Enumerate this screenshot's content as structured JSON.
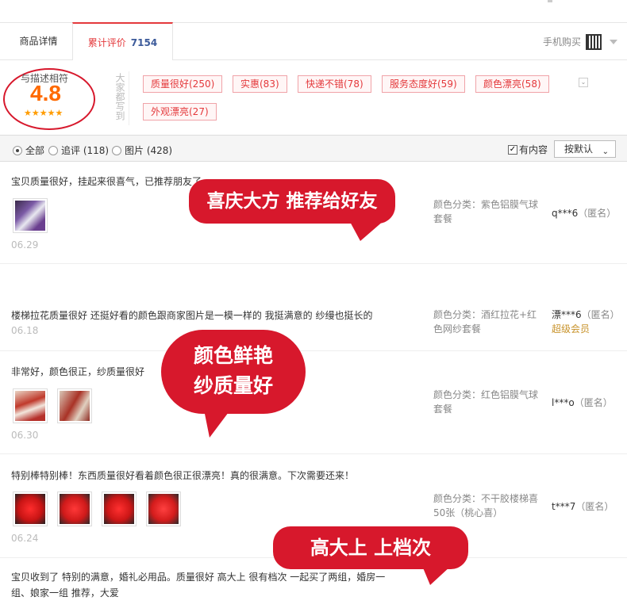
{
  "tabs": {
    "detail": "商品详情",
    "reviews": "累计评价",
    "review_count": "7154",
    "mobile": "手机购买"
  },
  "rating": {
    "label": "与描述相符",
    "score": "4.8",
    "stars": "★★★★★",
    "side_text": "大家都写到",
    "tags": [
      "质量很好(250)",
      "实惠(83)",
      "快递不错(78)",
      "服务态度好(59)",
      "颜色漂亮(58)",
      "外观漂亮(27)"
    ],
    "expand_icon": "chevron-down-icon"
  },
  "filter": {
    "all": "全部",
    "followup": "追评 (118)",
    "images": "图片 (428)",
    "has_content": "有内容",
    "sort": "按默认",
    "sort_caret": "⌄"
  },
  "reviews": [
    {
      "text": "宝贝质量很好，挂起来很喜气，已推荐朋友了",
      "date": "06.29",
      "meta": "颜色分类：紫色铝膜气球套餐",
      "user": "q***6",
      "anon": "（匿名）"
    },
    {
      "text": "楼梯拉花质量很好 还挺好看的颜色跟商家图片是一模一样的 我挺满意的 纱缦也挺长的",
      "date": "06.18",
      "meta": "颜色分类：酒红拉花+红色网纱套餐",
      "user": "漂***6",
      "anon": "（匿名）",
      "vip": "超级会员"
    },
    {
      "text": "非常好，颜色很正，纱质量很好",
      "date": "06.30",
      "meta": "颜色分类：红色铝膜气球套餐",
      "user": "l***o",
      "anon": "（匿名）"
    },
    {
      "text": "特别棒特别棒！东西质量很好看着颜色很正很漂亮！真的很满意。下次需要还来！",
      "date": "06.24",
      "meta": "颜色分类：不干胶楼梯喜50张（桃心喜）",
      "user": "t***7",
      "anon": "（匿名）"
    },
    {
      "text_line1": "宝贝收到了 特别的满意，婚礼必用品。质量很好 高大上 很有档次 一起买了两组，婚房一",
      "text_line2": "组、娘家一组 推荐，大爱"
    }
  ],
  "bubbles": {
    "b1": "喜庆大方 推荐给好友",
    "b2_line1": "颜色鲜艳",
    "b2_line2": "纱质量好",
    "b3": "高大上 上档次"
  },
  "colors": {
    "accent": "#e4393c",
    "bubble": "#d7182c",
    "score": "#ff6a00",
    "vip": "#c8932b"
  }
}
